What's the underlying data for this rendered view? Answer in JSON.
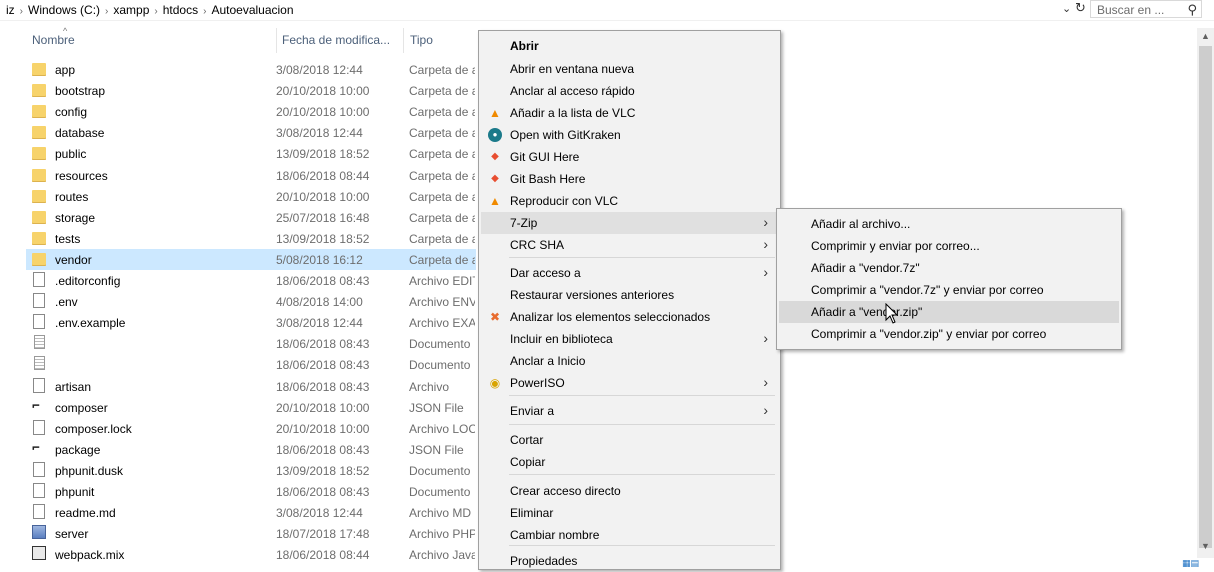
{
  "address": {
    "crumbs": [
      "iz",
      "Windows (C:)",
      "xampp",
      "htdocs",
      "Autoevaluacion"
    ],
    "separator": "›",
    "dropdown_glyph": "⌄",
    "refresh_glyph": "↻",
    "search_placeholder": "Buscar en ...",
    "search_icon": "search-icon"
  },
  "columns": {
    "name": "Nombre",
    "date": "Fecha de modifica...",
    "type": "Tipo"
  },
  "files": [
    {
      "name": "app",
      "date": "3/08/2018 12:44",
      "type": "Carpeta de a",
      "icon": "folder-icon"
    },
    {
      "name": "bootstrap",
      "date": "20/10/2018 10:00",
      "type": "Carpeta de a",
      "icon": "folder-icon"
    },
    {
      "name": "config",
      "date": "20/10/2018 10:00",
      "type": "Carpeta de a",
      "icon": "folder-icon"
    },
    {
      "name": "database",
      "date": "3/08/2018 12:44",
      "type": "Carpeta de a",
      "icon": "folder-icon"
    },
    {
      "name": "public",
      "date": "13/09/2018 18:52",
      "type": "Carpeta de a",
      "icon": "folder-icon"
    },
    {
      "name": "resources",
      "date": "18/06/2018 08:44",
      "type": "Carpeta de a",
      "icon": "folder-icon"
    },
    {
      "name": "routes",
      "date": "20/10/2018 10:00",
      "type": "Carpeta de a",
      "icon": "folder-icon"
    },
    {
      "name": "storage",
      "date": "25/07/2018 16:48",
      "type": "Carpeta de a",
      "icon": "folder-icon"
    },
    {
      "name": "tests",
      "date": "13/09/2018 18:52",
      "type": "Carpeta de a",
      "icon": "folder-icon"
    },
    {
      "name": "vendor",
      "date": "5/08/2018 16:12",
      "type": "Carpeta de a",
      "icon": "folder-icon",
      "selected": true
    },
    {
      "name": ".editorconfig",
      "date": "18/06/2018 08:43",
      "type": "Archivo EDIT",
      "icon": "file-icon"
    },
    {
      "name": ".env",
      "date": "4/08/2018 14:00",
      "type": "Archivo ENV",
      "icon": "file-icon"
    },
    {
      "name": ".env.example",
      "date": "3/08/2018 12:44",
      "type": "Archivo EXA",
      "icon": "file-icon"
    },
    {
      "name": "",
      "date": "18/06/2018 08:43",
      "type": "Documento",
      "icon": "document-icon"
    },
    {
      "name": "",
      "date": "18/06/2018 08:43",
      "type": "Documento",
      "icon": "document-icon"
    },
    {
      "name": "artisan",
      "date": "18/06/2018 08:43",
      "type": "Archivo",
      "icon": "file-icon"
    },
    {
      "name": "composer",
      "date": "20/10/2018 10:00",
      "type": "JSON File",
      "icon": "json-icon"
    },
    {
      "name": "composer.lock",
      "date": "20/10/2018 10:00",
      "type": "Archivo LOC",
      "icon": "file-icon"
    },
    {
      "name": "package",
      "date": "18/06/2018 08:43",
      "type": "JSON File",
      "icon": "json-icon"
    },
    {
      "name": "phpunit.dusk",
      "date": "13/09/2018 18:52",
      "type": "Documento",
      "icon": "file-icon"
    },
    {
      "name": "phpunit",
      "date": "18/06/2018 08:43",
      "type": "Documento",
      "icon": "file-icon"
    },
    {
      "name": "readme.md",
      "date": "3/08/2018 12:44",
      "type": "Archivo MD",
      "icon": "file-icon"
    },
    {
      "name": "server",
      "date": "18/07/2018 17:48",
      "type": "Archivo PHP",
      "icon": "php-icon"
    },
    {
      "name": "webpack.mix",
      "date": "18/06/2018 08:44",
      "type": "Archivo Java",
      "icon": "js-icon"
    }
  ],
  "context_menu": {
    "items": [
      {
        "label": "Abrir",
        "bold": true
      },
      {
        "label": "Abrir en ventana nueva"
      },
      {
        "label": "Anclar al acceso rápido"
      },
      {
        "label": "Añadir a la lista de VLC",
        "icon": "vlc-icon"
      },
      {
        "label": "Open with GitKraken",
        "icon": "gitkraken-icon"
      },
      {
        "label": "Git GUI Here",
        "icon": "git-gui-icon"
      },
      {
        "label": "Git Bash Here",
        "icon": "git-bash-icon"
      },
      {
        "label": "Reproducir con VLC",
        "icon": "vlc-icon"
      },
      {
        "label": "7-Zip",
        "submenu": true,
        "hover": true
      },
      {
        "label": "CRC SHA",
        "submenu": true
      },
      {
        "label": "Dar acceso a",
        "submenu": true
      },
      {
        "label": "Restaurar versiones anteriores"
      },
      {
        "label": "Analizar los elementos seleccionados",
        "icon": "analyze-icon"
      },
      {
        "label": "Incluir en biblioteca",
        "submenu": true
      },
      {
        "label": "Anclar a Inicio"
      },
      {
        "label": "PowerISO",
        "icon": "poweriso-icon",
        "submenu": true
      },
      {
        "label": "Enviar a",
        "submenu": true
      },
      {
        "label": "Cortar"
      },
      {
        "label": "Copiar"
      },
      {
        "label": "Crear acceso directo"
      },
      {
        "label": "Eliminar"
      },
      {
        "label": "Cambiar nombre"
      },
      {
        "label": "Propiedades"
      }
    ]
  },
  "submenu_7zip": {
    "items": [
      {
        "label": "Añadir al archivo..."
      },
      {
        "label": "Comprimir y enviar por correo..."
      },
      {
        "label": "Añadir a \"vendor.7z\""
      },
      {
        "label": "Comprimir a \"vendor.7z\" y enviar por correo"
      },
      {
        "label": "Añadir a \"vendor.zip\"",
        "hover": true
      },
      {
        "label": "Comprimir a \"vendor.zip\" y enviar por correo"
      }
    ]
  },
  "colors": {
    "selection": "#cce8ff",
    "menu_bg": "#f2f2f2",
    "menu_hover": "#e0e0e0",
    "header_text": "#4c607a"
  }
}
